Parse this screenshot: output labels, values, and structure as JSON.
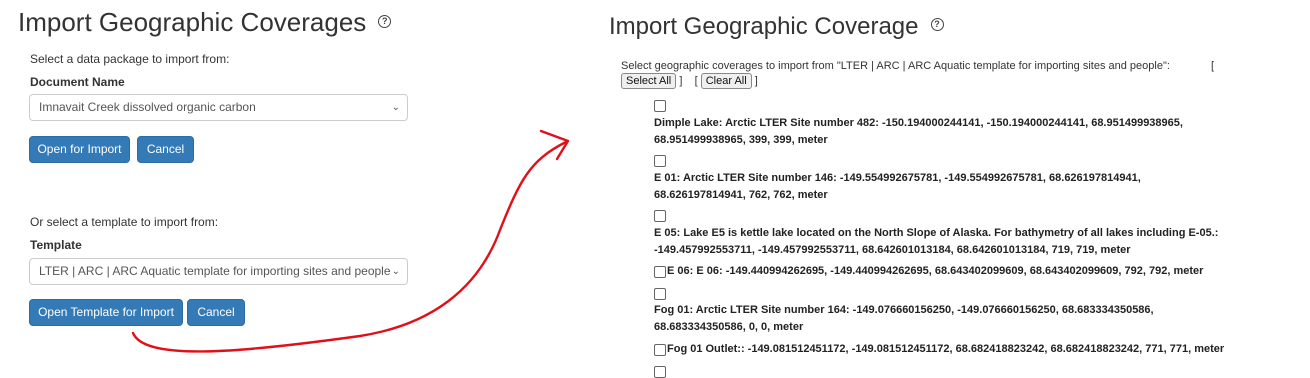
{
  "left": {
    "title": "Import Geographic Coverages",
    "help_glyph": "?",
    "select_package_label": "Select a data package to import from:",
    "document_name_label": "Document Name",
    "document_name_value": "Imnavait Creek dissolved organic carbon",
    "open_for_import_label": "Open for Import",
    "cancel_label": "Cancel",
    "select_template_label": "Or select a template to import from:",
    "template_label": "Template",
    "template_value": "LTER | ARC | ARC Aquatic template for importing sites and people",
    "open_template_label": "Open Template for Import",
    "cancel2_label": "Cancel"
  },
  "right": {
    "title": "Import Geographic Coverage",
    "help_glyph": "?",
    "select_text": "Select geographic coverages to import from \"LTER | ARC | ARC Aquatic template for importing sites and people\":",
    "bracket_open": "[",
    "bracket_close": "]",
    "select_all_label": "Select All",
    "clear_all_label": "Clear All",
    "coverages": [
      "Dimple Lake: Arctic LTER Site number 482: -150.194000244141, -150.194000244141, 68.951499938965, 68.951499938965, 399, 399, meter",
      "E 01: Arctic LTER Site number 146: -149.554992675781, -149.554992675781, 68.626197814941, 68.626197814941, 762, 762, meter",
      "E 05: Lake E5 is kettle lake located on the North Slope of Alaska. For bathymetry of all lakes including E-05.: -149.457992553711, -149.457992553711, 68.642601013184, 68.642601013184, 719, 719, meter",
      "E 06: E 06: -149.440994262695, -149.440994262695, 68.643402099609, 68.643402099609, 792, 792, meter",
      "Fog 01: Arctic LTER Site number 164: -149.076660156250, -149.076660156250, 68.683334350586, 68.683334350586, 0, 0, meter",
      "Fog 01 Outlet:: -149.081512451172, -149.081512451172, 68.682418823242, 68.682418823242, 771, 771, meter"
    ]
  },
  "colors": {
    "primary_button": "#337ab7",
    "arrow": "#e0101a"
  }
}
